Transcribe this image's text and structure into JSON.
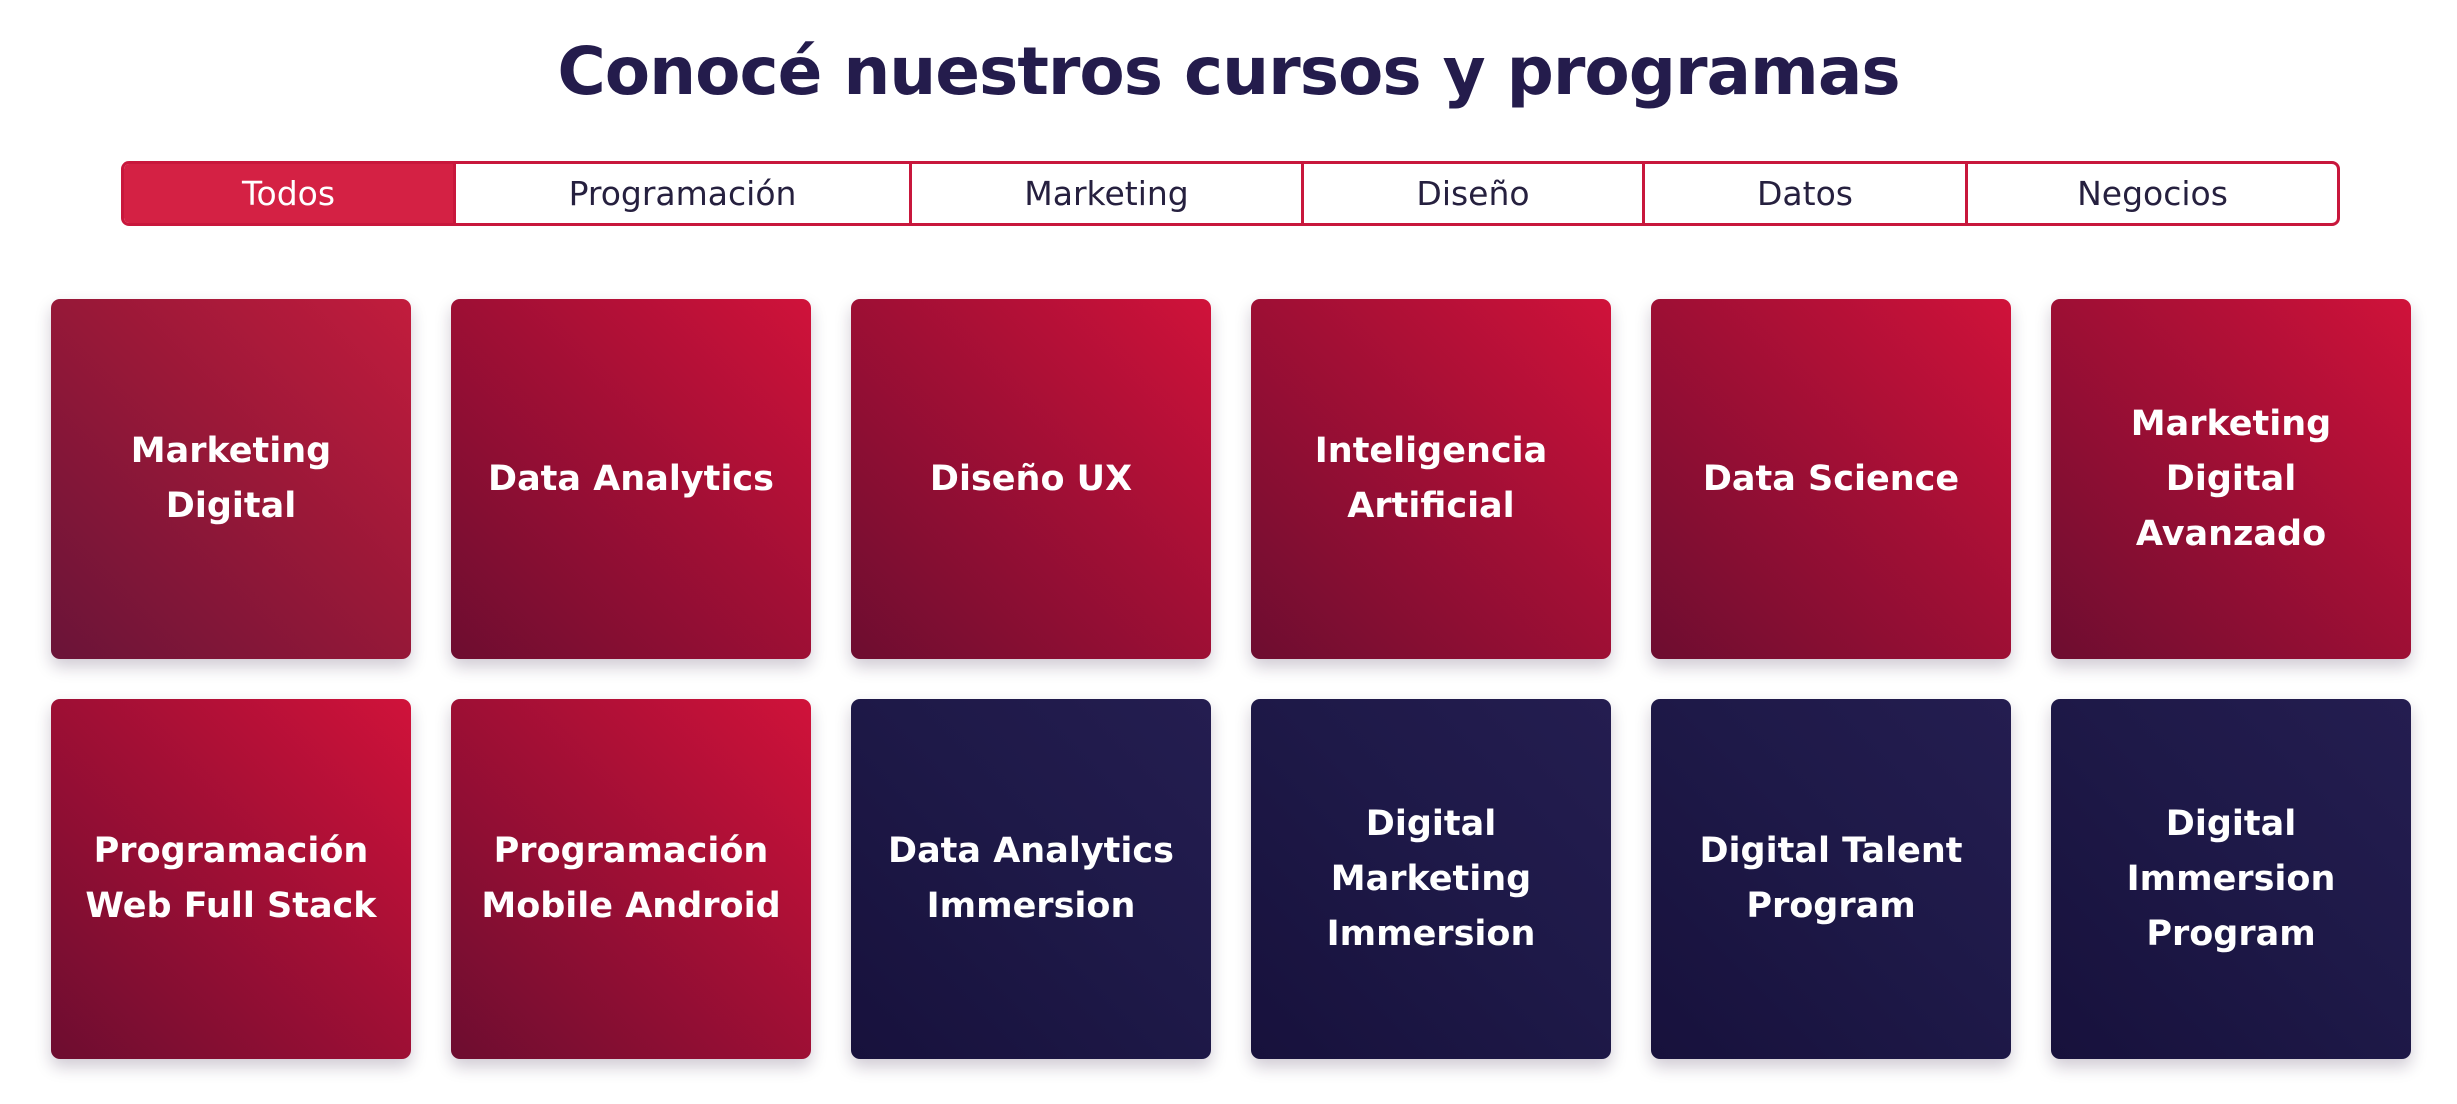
{
  "heading": "Conocé nuestros cursos y programas",
  "colors": {
    "brand_red": "#d42144",
    "brand_navy": "#241c4c",
    "tab_border": "#c8173c"
  },
  "tabs": [
    {
      "label": "Todos",
      "active": true
    },
    {
      "label": "Programación",
      "active": false
    },
    {
      "label": "Marketing",
      "active": false
    },
    {
      "label": "Diseño",
      "active": false
    },
    {
      "label": "Datos",
      "active": false
    },
    {
      "label": "Negocios",
      "active": false
    }
  ],
  "courses": [
    {
      "label": "Marketing Digital",
      "theme": "red"
    },
    {
      "label": "Data Analytics",
      "theme": "red"
    },
    {
      "label": "Diseño UX",
      "theme": "red"
    },
    {
      "label": "Inteligencia Artificial",
      "theme": "red"
    },
    {
      "label": "Data Science",
      "theme": "red"
    },
    {
      "label": "Marketing Digital Avanzado",
      "theme": "red"
    },
    {
      "label": "Programación Web Full Stack",
      "theme": "red"
    },
    {
      "label": "Programación Mobile Android",
      "theme": "red"
    },
    {
      "label": "Data Analytics Immersion",
      "theme": "navy"
    },
    {
      "label": "Digital Marketing Immersion",
      "theme": "navy"
    },
    {
      "label": "Digital Talent Program",
      "theme": "navy"
    },
    {
      "label": "Digital Immersion Program",
      "theme": "navy"
    }
  ]
}
